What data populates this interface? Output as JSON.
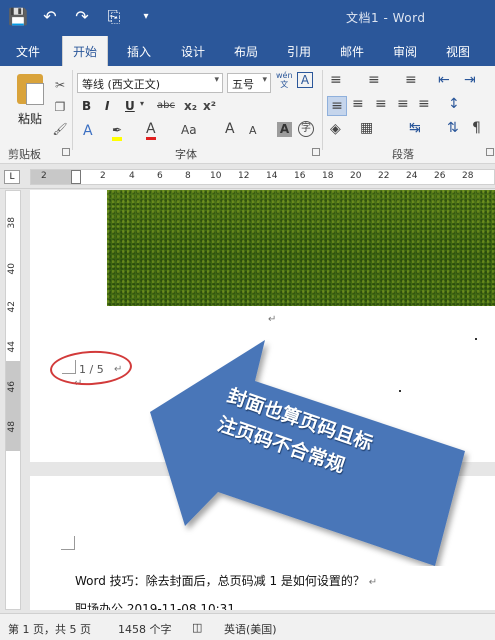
{
  "window": {
    "title": "文档1 - Word"
  },
  "quick_access": {
    "icons": [
      "save-icon",
      "undo-icon",
      "redo-icon",
      "print-preview-icon",
      "customize-icon"
    ]
  },
  "tabs": [
    {
      "label": "文件"
    },
    {
      "label": "开始",
      "active": true
    },
    {
      "label": "插入"
    },
    {
      "label": "设计"
    },
    {
      "label": "布局"
    },
    {
      "label": "引用"
    },
    {
      "label": "邮件"
    },
    {
      "label": "审阅"
    },
    {
      "label": "视图"
    }
  ],
  "ribbon": {
    "clipboard": {
      "paste_label": "粘贴",
      "group_label": "剪贴板"
    },
    "font": {
      "font_name": "等线 (西文正文)",
      "font_size": "五号",
      "group_label": "字体",
      "phonetic_label": "wén\n文",
      "bold": "B",
      "italic": "I",
      "underline": "U",
      "strike": "abc",
      "subscript": "x₂",
      "superscript": "x²",
      "case": "Aa",
      "grow": "A",
      "shrink": "A",
      "circle_char": "字"
    },
    "paragraph": {
      "group_label": "段落"
    }
  },
  "ruler": {
    "tab_selector": "L",
    "h_ticks": [
      "2",
      "2",
      "4",
      "6",
      "8",
      "10",
      "12",
      "14",
      "16",
      "18",
      "20",
      "22",
      "24",
      "26",
      "28"
    ],
    "v_ticks": [
      "38",
      "40",
      "42",
      "44",
      "46",
      "48"
    ]
  },
  "document": {
    "page_number": "1 / 5",
    "callout_line1": "封面也算页码且标",
    "callout_line2": "注页码不合常规",
    "line1": "Word 技巧：除去封面后，总页码减 1 是如何设置的？",
    "line2": "职场办公 2019-11-08 10:31"
  },
  "status": {
    "page": "第 1 页，共 5 页",
    "words": "1458 个字",
    "language": "英语(美国)"
  },
  "colors": {
    "accent": "#2b579a",
    "callout": "#4a76b8",
    "ellipse": "#d23a3a"
  }
}
